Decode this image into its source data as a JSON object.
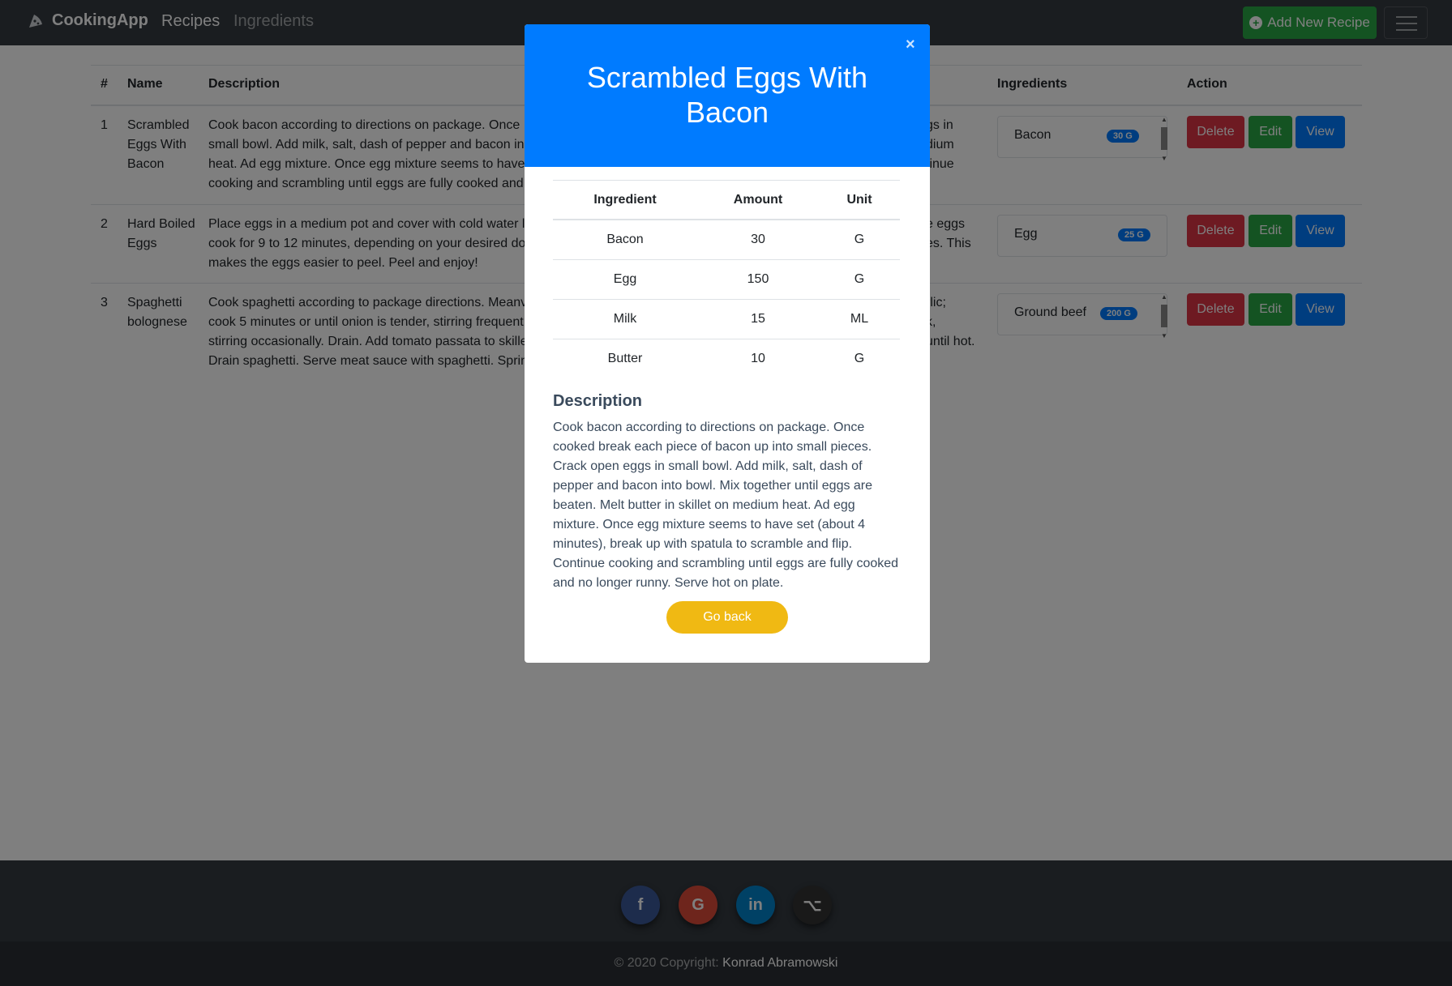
{
  "navbar": {
    "brand": "CookingApp",
    "links": [
      "Recipes",
      "Ingredients"
    ],
    "add_button": "Add New Recipe"
  },
  "table": {
    "headers": [
      "#",
      "Name",
      "Description",
      "Ingredients",
      "Action"
    ],
    "rows": [
      {
        "num": "1",
        "name": "Scrambled Eggs With Bacon",
        "description_left": "Cook bacon according to directions on package. Once small bowl. Add milk, salt, dash of pepper and bacon in heat. Ad egg mixture. Once egg mixture seems to have cooking and scrambling until eggs are fully cooked and",
        "description_right": "gs in\ndium\ntinue",
        "ingredient": "Bacon",
        "badge": "30 G"
      },
      {
        "num": "2",
        "name": "Hard Boiled Eggs",
        "description_left": "Place eggs in a medium pot and cover with cold water l cook for 9 to 12 minutes, depending on your desired do makes the eggs easier to peel. Peel and enjoy!",
        "description_right": "e eggs\nes. This",
        "ingredient": "Egg",
        "badge": "25 G"
      },
      {
        "num": "3",
        "name": "Spaghetti bolognese",
        "description_left": "Cook spaghetti according to package directions. Meanv cook 5 minutes or until onion is tender, stirring frequent stirring occasionally. Drain. Add tomato passata to skille Drain spaghetti. Serve meat sauce with spaghetti. Sprin",
        "description_right": "rlic;\nk,\nuntil hot.",
        "ingredient": "Ground beef",
        "badge": "200 G"
      }
    ],
    "actions": {
      "delete": "Delete",
      "edit": "Edit",
      "view": "View"
    }
  },
  "modal": {
    "title": "Scrambled Eggs With Bacon",
    "close": "×",
    "table_headers": [
      "Ingredient",
      "Amount",
      "Unit"
    ],
    "ingredients": [
      {
        "name": "Bacon",
        "amount": "30",
        "unit": "G"
      },
      {
        "name": "Egg",
        "amount": "150",
        "unit": "G"
      },
      {
        "name": "Milk",
        "amount": "15",
        "unit": "ML"
      },
      {
        "name": "Butter",
        "amount": "10",
        "unit": "G"
      }
    ],
    "description_heading": "Description",
    "description": "Cook bacon according to directions on package. Once cooked break each piece of bacon up into small pieces. Crack open eggs in small bowl. Add milk, salt, dash of pepper and bacon into bowl. Mix together until eggs are beaten. Melt butter in skillet on medium heat. Ad egg mixture. Once egg mixture seems to have set (about 4 minutes), break up with spatula to scramble and flip. Continue cooking and scrambling until eggs are fully cooked and no longer runny. Serve hot on plate.",
    "go_back": "Go back"
  },
  "footer": {
    "social_icons": [
      "facebook-icon",
      "google-icon",
      "linkedin-icon",
      "github-icon"
    ],
    "social_glyphs": [
      "f",
      "G",
      "in",
      "⌥"
    ],
    "copyright_label": "© 2020 Copyright: ",
    "author": "Konrad Abramowski"
  },
  "colors": {
    "primary": "#007bff",
    "success": "#28a745",
    "danger": "#dc3545",
    "warning": "#f0b913",
    "navbar": "#343a40"
  }
}
